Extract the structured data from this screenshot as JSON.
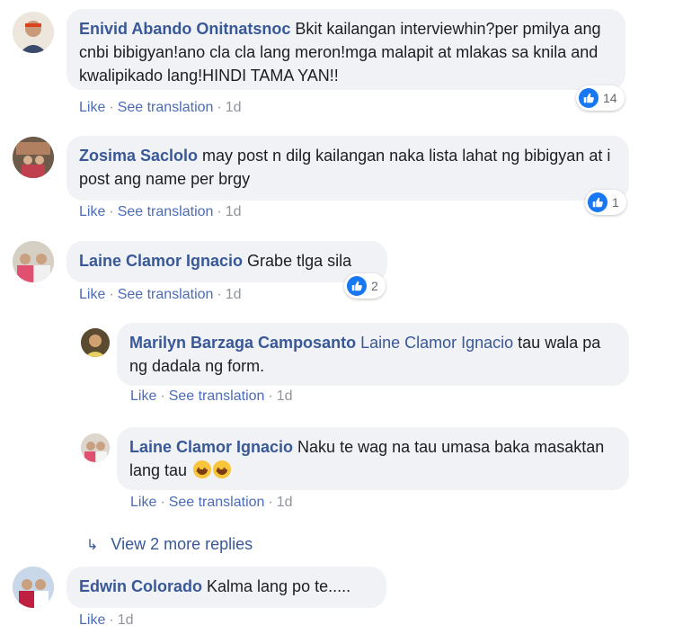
{
  "comments": [
    {
      "author": "Enivid Abando Onitnatsnoc",
      "text": "Bkit kailangan interviewhin?per pmilya ang cnbi bibigyan!ano cla cla lang meron!mga malapit at mlakas sa knila and kwalipikado lang!HINDI TAMA YAN!!",
      "like": "Like",
      "see_translation": "See translation",
      "time": "1d",
      "reactions": "14"
    },
    {
      "author": "Zosima Saclolo",
      "text": "may post n dilg kailangan naka lista lahat ng bibigyan at i post ang name per brgy",
      "like": "Like",
      "see_translation": "See translation",
      "time": "1d",
      "reactions": "1"
    },
    {
      "author": "Laine Clamor Ignacio",
      "text": "Grabe tlga sila",
      "like": "Like",
      "see_translation": "See translation",
      "time": "1d",
      "reactions": "2"
    }
  ],
  "replies": [
    {
      "author": "Marilyn Barzaga Camposanto",
      "mention": "Laine Clamor Ignacio",
      "text": " tau wala pa ng dadala ng form.",
      "like": "Like",
      "see_translation": "See translation",
      "time": "1d"
    },
    {
      "author": "Laine Clamor Ignacio",
      "text": "Naku te wag na tau umasa baka masaktan lang tau",
      "like": "Like",
      "see_translation": "See translation",
      "time": "1d"
    }
  ],
  "more_replies": "View 2 more replies",
  "last_comment": {
    "author": "Edwin Colorado",
    "text": "Kalma lang po te.....",
    "like": "Like",
    "time": "1d"
  },
  "colors": {
    "link": "#385898",
    "bubble": "#f0f2f5",
    "like_blue": "#1877f2",
    "meta": "#90949c"
  }
}
